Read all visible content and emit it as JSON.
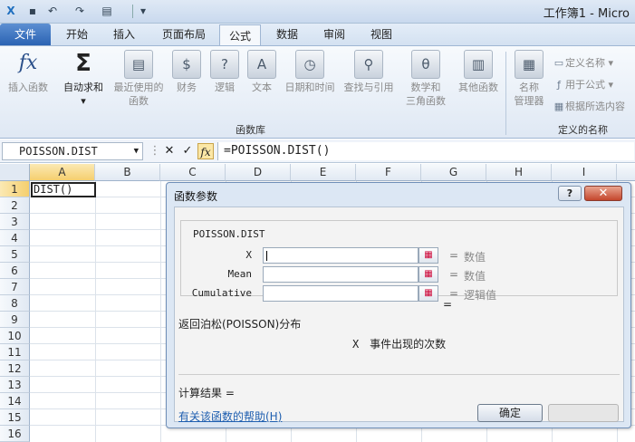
{
  "title_bar": {
    "document_title": "工作簿1 - Micro",
    "quick_access": [
      "save-icon",
      "undo-icon",
      "redo-icon",
      "print-preview-icon",
      "customize-icon"
    ]
  },
  "tabs": [
    {
      "label": "文件"
    },
    {
      "label": "开始"
    },
    {
      "label": "插入"
    },
    {
      "label": "页面布局"
    },
    {
      "label": "公式"
    },
    {
      "label": "数据"
    },
    {
      "label": "审阅"
    },
    {
      "label": "视图"
    }
  ],
  "ribbon": {
    "insert_function": {
      "label": "插入函数",
      "icon": "fx-icon"
    },
    "autosum": {
      "label": "自动求和",
      "icon": "sigma-icon"
    },
    "recent": {
      "label1": "最近使用的",
      "label2": "函数"
    },
    "financial": {
      "label": "财务"
    },
    "logical": {
      "label": "逻辑"
    },
    "text": {
      "label": "文本"
    },
    "datetime": {
      "label": "日期和时间"
    },
    "lookup": {
      "label": "查找与引用"
    },
    "math": {
      "label1": "数学和",
      "label2": "三角函数"
    },
    "more": {
      "label": "其他函数"
    },
    "function_library_label": "函数库",
    "name_manager": {
      "label1": "名称",
      "label2": "管理器"
    },
    "define_name": "定义名称",
    "use_in_formula": "用于公式",
    "create_from_selection": "根据所选内容",
    "defined_names_label": "定义的名称"
  },
  "formula_bar": {
    "name_box": "POISSON.DIST",
    "cancel": "✕",
    "enter": "✓",
    "fx": "fx",
    "formula": "=POISSON.DIST()"
  },
  "grid": {
    "columns": [
      "A",
      "B",
      "C",
      "D",
      "E",
      "F",
      "G",
      "H",
      "I"
    ],
    "rows": [
      "1",
      "2",
      "3",
      "4",
      "5",
      "6",
      "7",
      "8",
      "9",
      "10",
      "11",
      "12",
      "13",
      "14",
      "15",
      "16"
    ],
    "a1_value": "DIST()"
  },
  "dialog": {
    "title": "函数参数",
    "help_button": "?",
    "close_button": "✕",
    "function_name": "POISSON.DIST",
    "args": [
      {
        "name": "X",
        "value": "",
        "result": "数值"
      },
      {
        "name": "Mean",
        "value": "",
        "result": "数值"
      },
      {
        "name": "Cumulative",
        "value": "",
        "result": "逻辑值"
      }
    ],
    "equals": "=",
    "description": "返回泊松(POISSON)分布",
    "arg_desc_name": "X",
    "arg_desc_text": "事件出现的次数",
    "result_label": "计算结果 =",
    "help_link": "有关该函数的帮助(H)",
    "ok": "确定",
    "cancel": ""
  }
}
